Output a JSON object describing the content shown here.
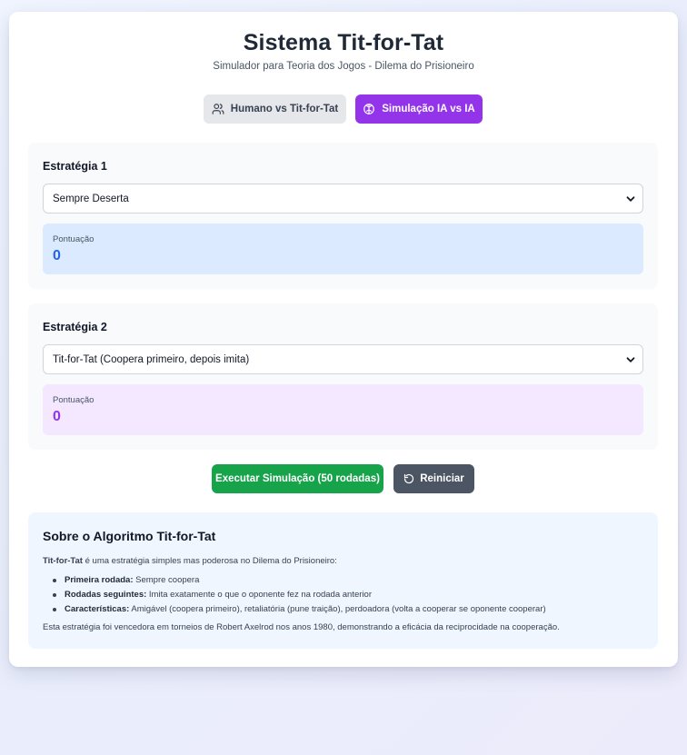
{
  "header": {
    "title": "Sistema Tit-for-Tat",
    "subtitle": "Simulador para Teoria dos Jogos - Dilema do Prisioneiro"
  },
  "modes": {
    "human_label": "Humano vs Tit-for-Tat",
    "ai_label": "Simulação IA vs IA",
    "active": "ai"
  },
  "strategy1": {
    "label": "Estratégia 1",
    "selected": "Sempre Deserta",
    "score_label": "Pontuação",
    "score": "0"
  },
  "strategy2": {
    "label": "Estratégia 2",
    "selected": "Tit-for-Tat (Coopera primeiro, depois imita)",
    "score_label": "Pontuação",
    "score": "0"
  },
  "actions": {
    "run_label": "Executar Simulação (50 rodadas)",
    "reset_label": "Reiniciar"
  },
  "about": {
    "title": "Sobre o Algoritmo Tit-for-Tat",
    "intro_bold": "Tit-for-Tat",
    "intro_rest": " é uma estratégia simples mas poderosa no Dilema do Prisioneiro:",
    "items": [
      {
        "term": "Primeira rodada:",
        "text": " Sempre coopera"
      },
      {
        "term": "Rodadas seguintes:",
        "text": " Imita exatamente o que o oponente fez na rodada anterior"
      },
      {
        "term": "Características:",
        "text": " Amigável (coopera primeiro), retaliatória (pune traição), perdoadora (volta a cooperar se oponente cooperar)"
      }
    ],
    "footer": "Esta estratégia foi vencedora em torneios de Robert Axelrod nos anos 1980, demonstrando a eficácia da reciprocidade na cooperação."
  },
  "colors": {
    "accent_purple": "#9333ea",
    "run_green": "#16a34a",
    "reset_gray": "#4b5563",
    "score1_blue": "#2563eb"
  },
  "icons": {
    "human_mode": "users-icon",
    "ai_mode": "brain-icon",
    "reset": "rotate-ccw-icon",
    "select": "chevron-down-icon"
  }
}
